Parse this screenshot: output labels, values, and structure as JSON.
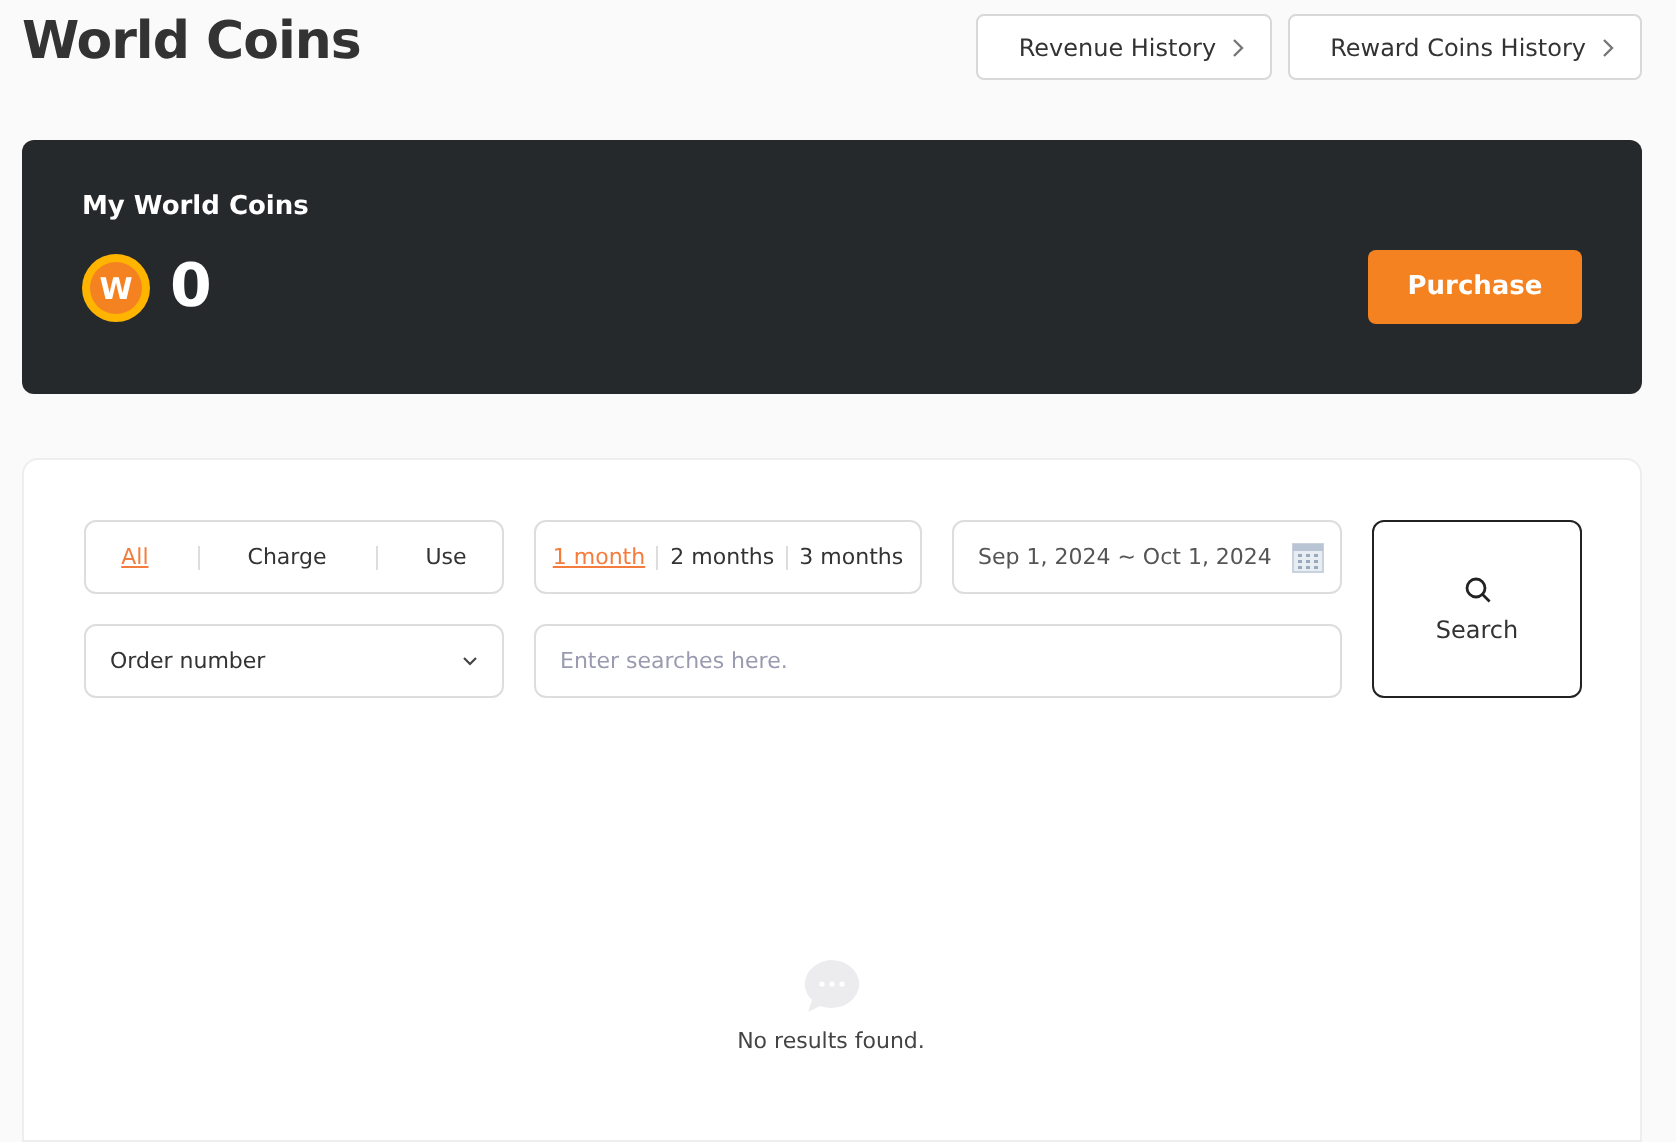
{
  "page_title": "World Coins",
  "header_buttons": [
    {
      "label": "Revenue History"
    },
    {
      "label": "Reward Coins History"
    }
  ],
  "balance_card": {
    "title": "My World Coins",
    "coin_letter": "W",
    "amount": "0",
    "button": "Purchase"
  },
  "type_tabs": [
    {
      "label": "All",
      "selected": true
    },
    {
      "label": "Charge",
      "selected": false
    },
    {
      "label": "Use",
      "selected": false
    }
  ],
  "period_tabs": [
    {
      "label": "1 month",
      "selected": true
    },
    {
      "label": "2 months",
      "selected": false
    },
    {
      "label": "3 months",
      "selected": false
    }
  ],
  "date_range": {
    "value": "Sep 1, 2024 ~ Oct 1, 2024"
  },
  "search_button": {
    "label": "Search"
  },
  "search_type": {
    "value": "Order number"
  },
  "search_field": {
    "placeholder": "Enter searches here."
  },
  "empty_state": {
    "message": "No results found."
  }
}
